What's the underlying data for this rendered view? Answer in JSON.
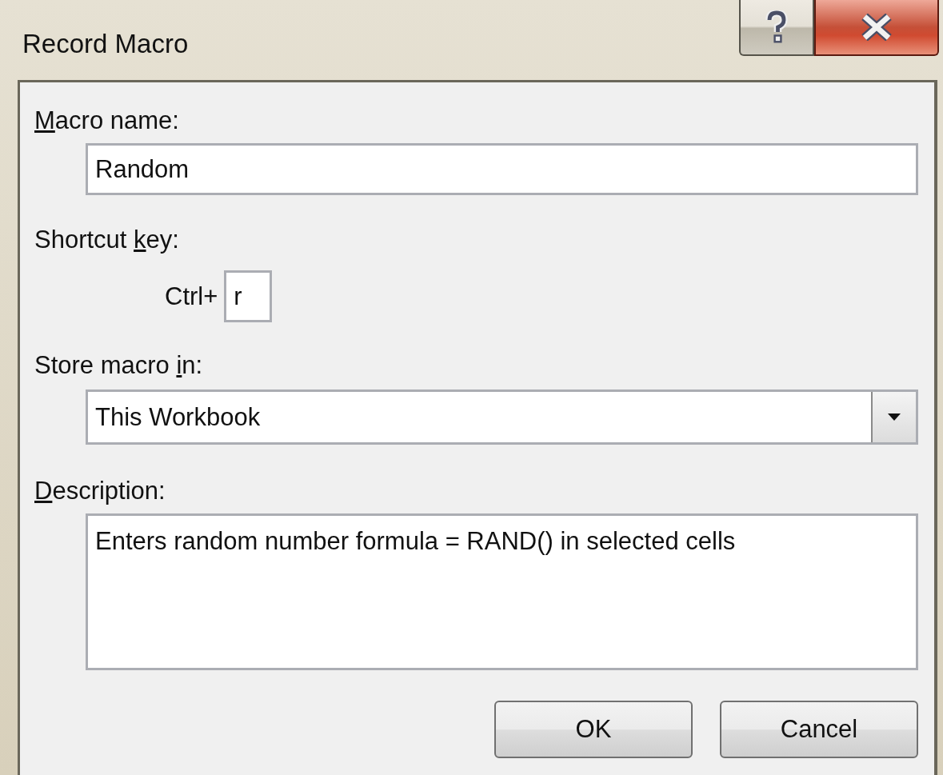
{
  "window": {
    "title": "Record Macro"
  },
  "macro_name": {
    "label": {
      "key": "M",
      "after": "acro name:"
    },
    "value": "Random"
  },
  "shortcut": {
    "label": {
      "before": "Shortcut ",
      "key": "k",
      "after": "ey:"
    },
    "prefix": "Ctrl+",
    "value": "r"
  },
  "store_in": {
    "label": {
      "before": "Store macro ",
      "key": "i",
      "after": "n:"
    },
    "value": "This Workbook"
  },
  "description": {
    "label": {
      "key": "D",
      "after": "escription:"
    },
    "value": "Enters random number formula = RAND() in selected cells"
  },
  "buttons": [
    {
      "label": "OK"
    },
    {
      "label": "Cancel"
    }
  ]
}
